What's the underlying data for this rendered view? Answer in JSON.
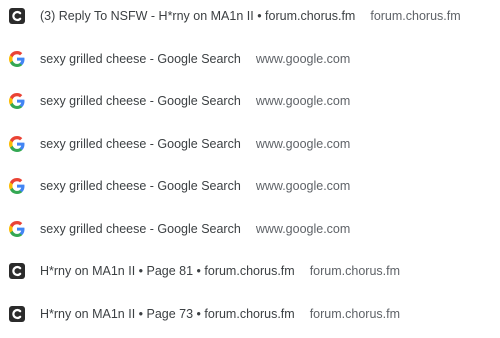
{
  "history": {
    "items": [
      {
        "favicon": "chorus-icon",
        "title": "(3) Reply To NSFW - H*rny on MA1n II • forum.chorus.fm",
        "url": "forum.chorus.fm"
      },
      {
        "favicon": "google-icon",
        "title": "sexy grilled cheese - Google Search",
        "url": "www.google.com"
      },
      {
        "favicon": "google-icon",
        "title": "sexy grilled cheese - Google Search",
        "url": "www.google.com"
      },
      {
        "favicon": "google-icon",
        "title": "sexy grilled cheese - Google Search",
        "url": "www.google.com"
      },
      {
        "favicon": "google-icon",
        "title": "sexy grilled cheese - Google Search",
        "url": "www.google.com"
      },
      {
        "favicon": "google-icon",
        "title": "sexy grilled cheese - Google Search",
        "url": "www.google.com"
      },
      {
        "favicon": "chorus-icon",
        "title": "H*rny on MA1n II • Page 81 • forum.chorus.fm",
        "url": "forum.chorus.fm"
      },
      {
        "favicon": "chorus-icon",
        "title": "H*rny on MA1n II • Page 73 • forum.chorus.fm",
        "url": "forum.chorus.fm"
      }
    ]
  }
}
